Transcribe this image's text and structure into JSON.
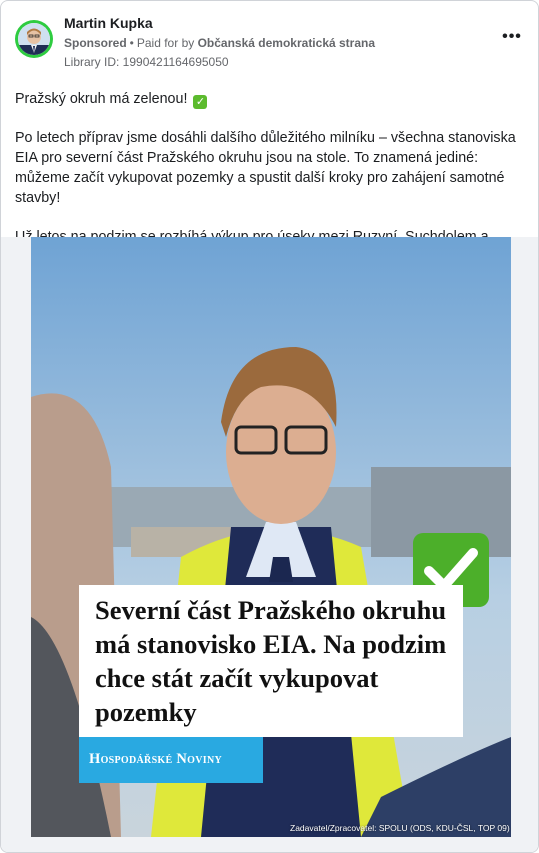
{
  "post": {
    "author": "Martin Kupka",
    "sponsored": "Sponsored",
    "separator": "•",
    "paid_for_prefix": "Paid for by",
    "paid_for_by": "Občanská demokratická strana",
    "library_id": "Library ID: 1990421164695050",
    "more_icon": "more-horizontal-icon",
    "avatar_ring_color": "#2ecc40"
  },
  "text": {
    "p1": "Pražský okruh má zelenou!",
    "p1_emoji": "✓",
    "p2": "Po letech příprav jsme dosáhli dalšího důležitého milníku – všechna stanoviska EIA pro severní část Pražského okruhu jsou na stole. To znamená jediné: můžeme začít vykupovat pozemky a spustit další kroky pro zahájení samotné stavby!",
    "p3": "Už letos na podzim se rozbíhá výkup pro úseky mezi Ruzyní, Suchdolem a…"
  },
  "media": {
    "headline": "Severní část Pražského okruhu má stanovisko EIA. Na podzim chce stát začít vykupovat pozemky",
    "brand": "Hospodářské Noviny",
    "brand_color": "#29a9e1",
    "check_color": "#4caf2a",
    "credit": "Zadavatel/Zpracovatel: SPOLU (ODS, KDU-ČSL, TOP 09)"
  }
}
